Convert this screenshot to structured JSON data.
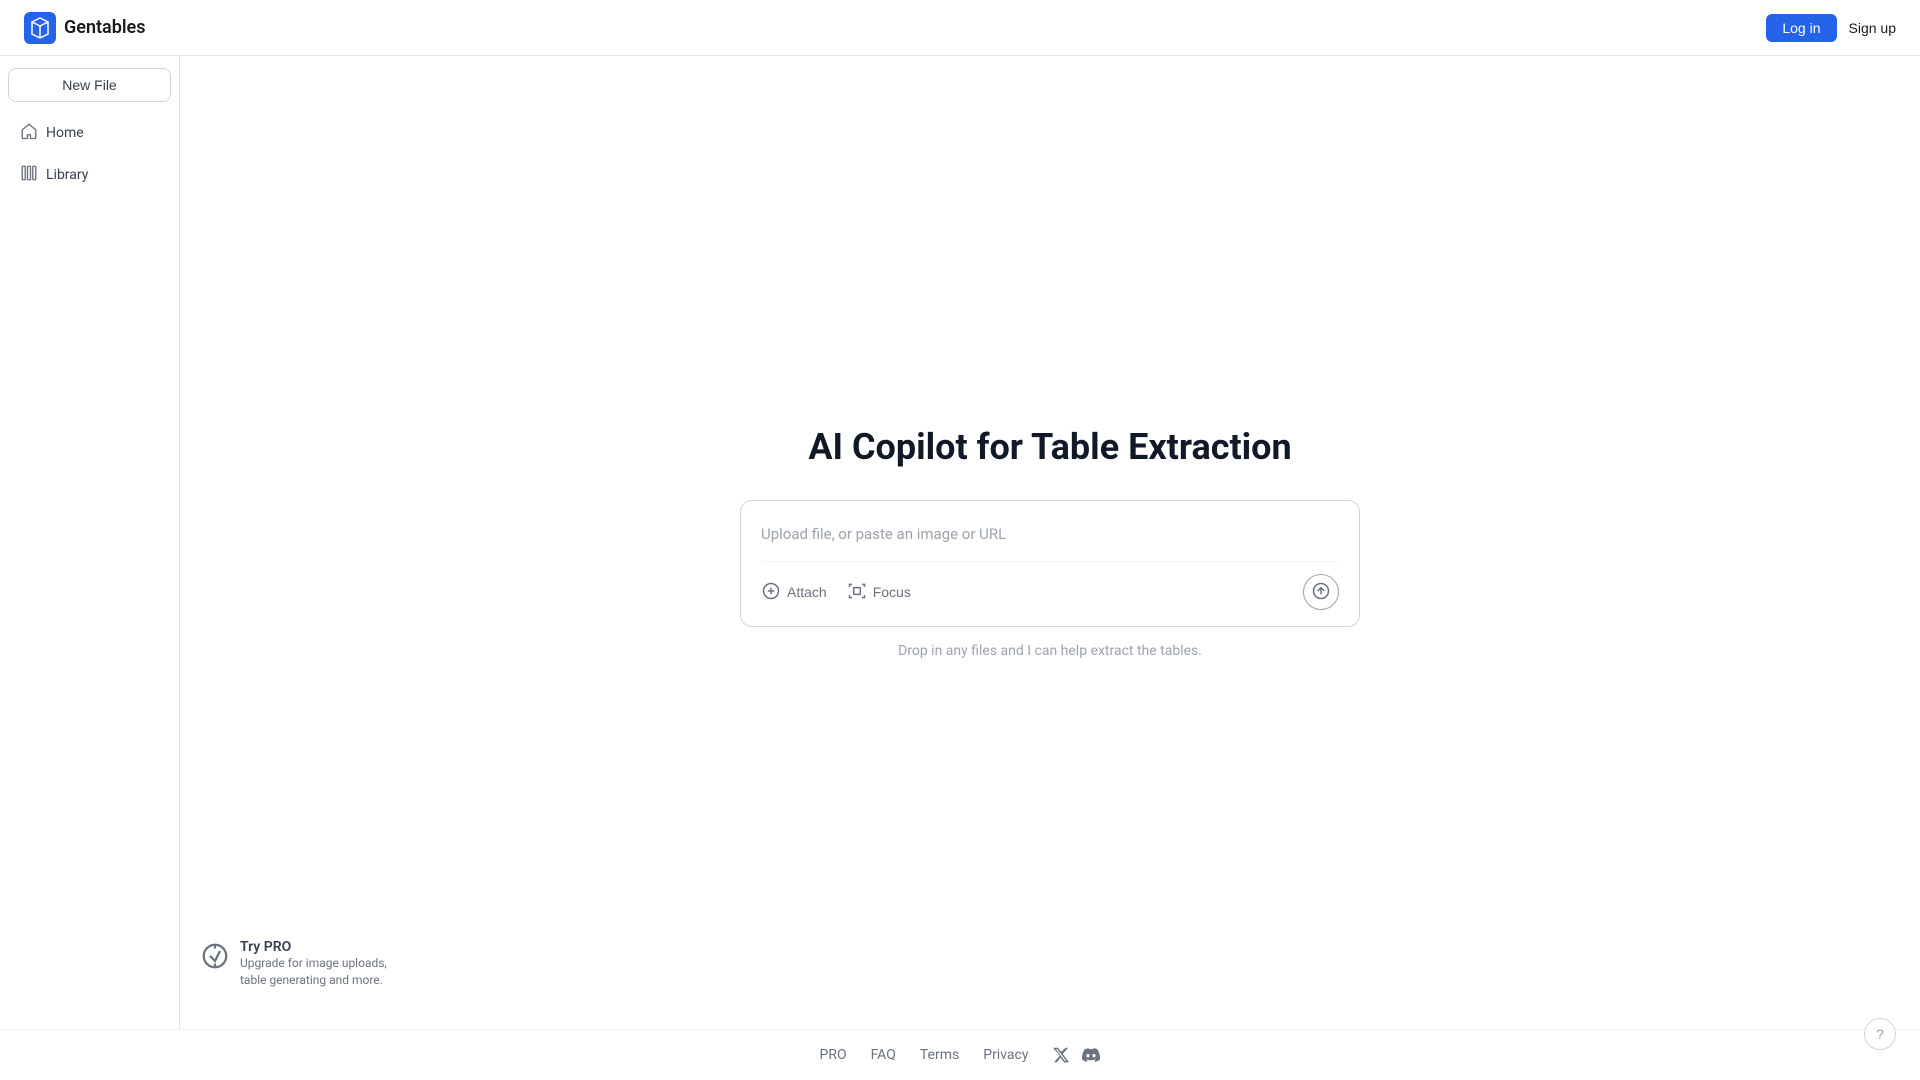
{
  "header": {
    "logo_text": "Gentables",
    "login_label": "Log in",
    "signup_label": "Sign up"
  },
  "sidebar": {
    "new_file_label": "New File",
    "items": [
      {
        "id": "home",
        "label": "Home",
        "icon": "home-icon"
      },
      {
        "id": "library",
        "label": "Library",
        "icon": "library-icon"
      }
    ]
  },
  "main": {
    "title": "AI Copilot for Table Extraction",
    "input_placeholder": "Upload file, or paste an image or URL",
    "attach_label": "Attach",
    "focus_label": "Focus",
    "drop_hint": "Drop in any files and I can help extract the tables."
  },
  "promo": {
    "title": "Try PRO",
    "description": "Upgrade for image uploads, table generating and more."
  },
  "footer": {
    "links": [
      "PRO",
      "FAQ",
      "Terms",
      "Privacy"
    ]
  }
}
